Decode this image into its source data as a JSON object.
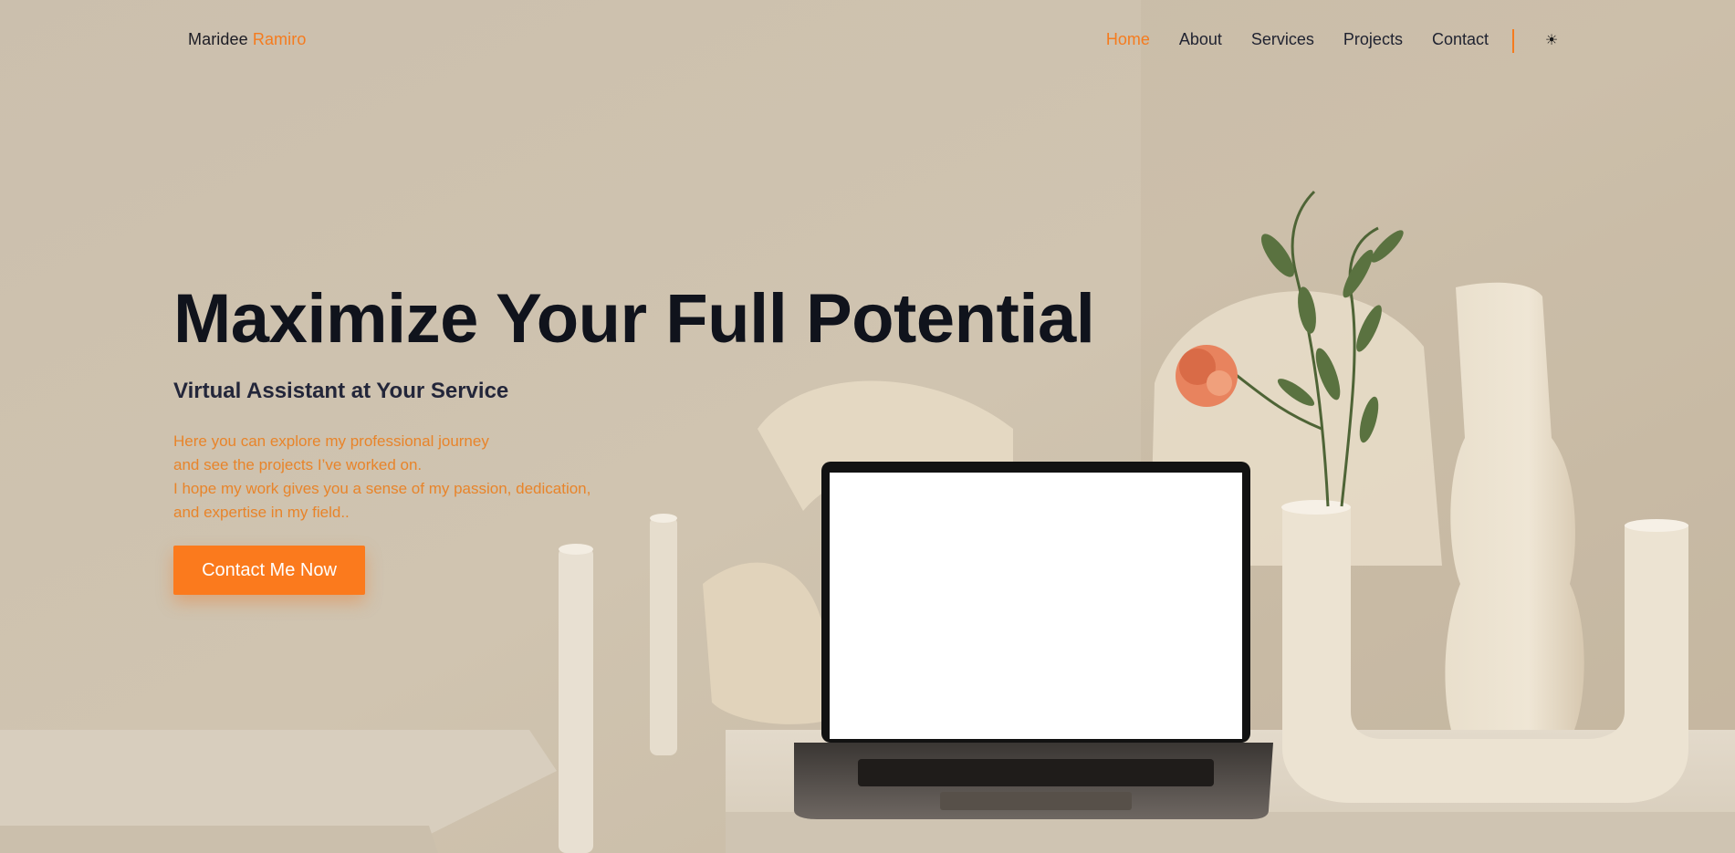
{
  "brand": {
    "first": "Maridee",
    "last": "Ramiro"
  },
  "nav": {
    "items": [
      {
        "label": "Home",
        "active": true
      },
      {
        "label": "About"
      },
      {
        "label": "Services"
      },
      {
        "label": "Projects"
      },
      {
        "label": "Contact"
      }
    ],
    "theme_toggle_icon": "☀"
  },
  "hero": {
    "title": "Maximize Your Full Potential",
    "subtitle": "Virtual Assistant at Your Service",
    "intro_lines": [
      "Here you can explore my professional journey",
      "and see the projects I’ve worked on.",
      "I hope my work gives you a sense of my passion, dedication,",
      "and expertise in my field.."
    ],
    "cta_label": "Contact Me Now"
  },
  "colors": {
    "accent": "#f57b1e",
    "text_dark": "#10131c",
    "background": "#c9bca8"
  }
}
